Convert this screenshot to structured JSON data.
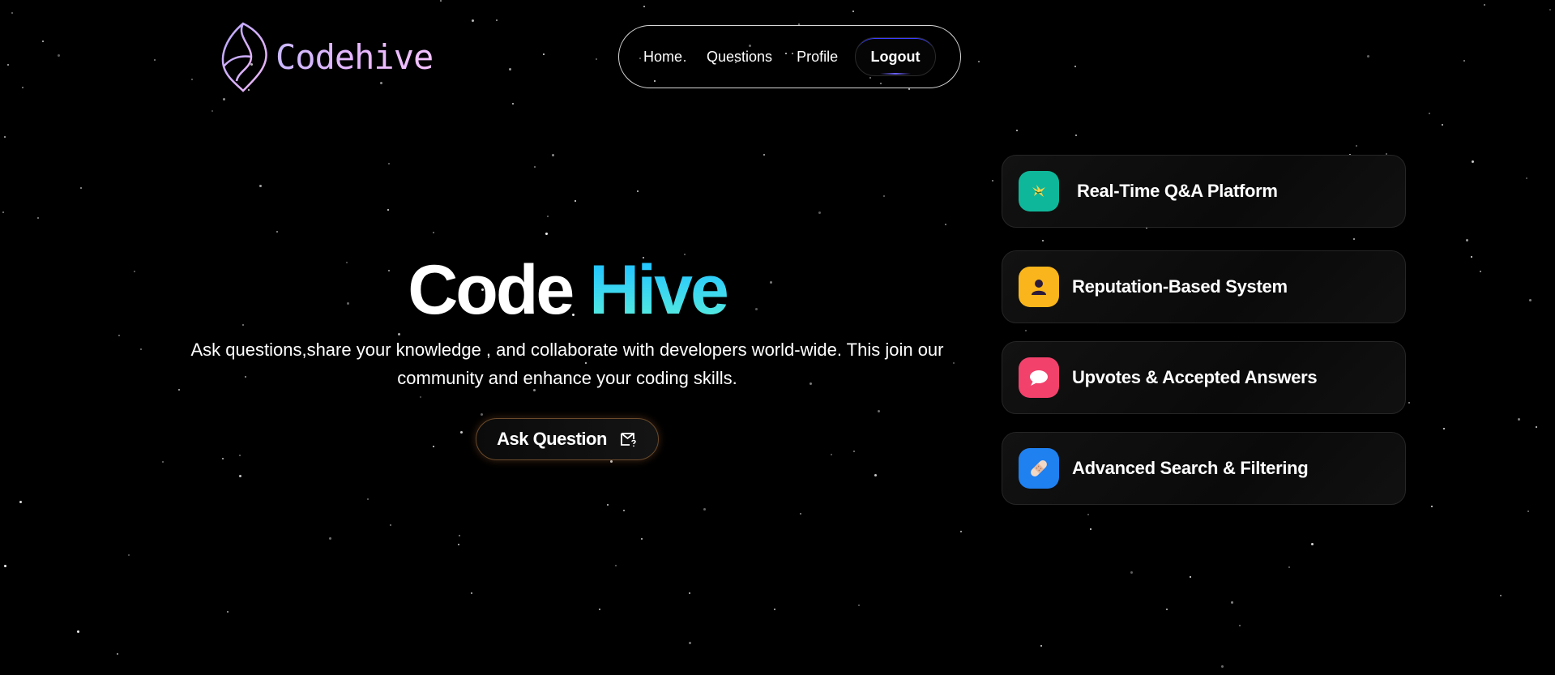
{
  "brand": {
    "name": "Codehive"
  },
  "nav": {
    "links": [
      "Home",
      "Questions",
      "Profile"
    ],
    "logout": "Logout"
  },
  "hero": {
    "title_part1": "Code",
    "title_part2": "Hive",
    "description": "Ask questions,share your knowledge , and collaborate with developers world-wide. This join our community and enhance your coding skills.",
    "cta_label": "Ask Question",
    "cta_icon": "mail-question-icon"
  },
  "features": [
    {
      "label": "Real-Time Q&A Platform",
      "icon": "bird-icon",
      "color": "#0fb79a"
    },
    {
      "label": "Reputation-Based System",
      "icon": "user-icon",
      "color": "#f9b51b"
    },
    {
      "label": "Upvotes & Accepted Answers",
      "icon": "chat-bubble-icon",
      "color": "#f2416b"
    },
    {
      "label": "Advanced Search & Filtering",
      "icon": "bandage-icon",
      "color": "#1f80f0"
    }
  ],
  "colors": {
    "background": "#000000",
    "accent_cyan": "#25c7ff",
    "accent_teal": "#5ff0d8",
    "logo_lavender": "#d4b8ff"
  }
}
